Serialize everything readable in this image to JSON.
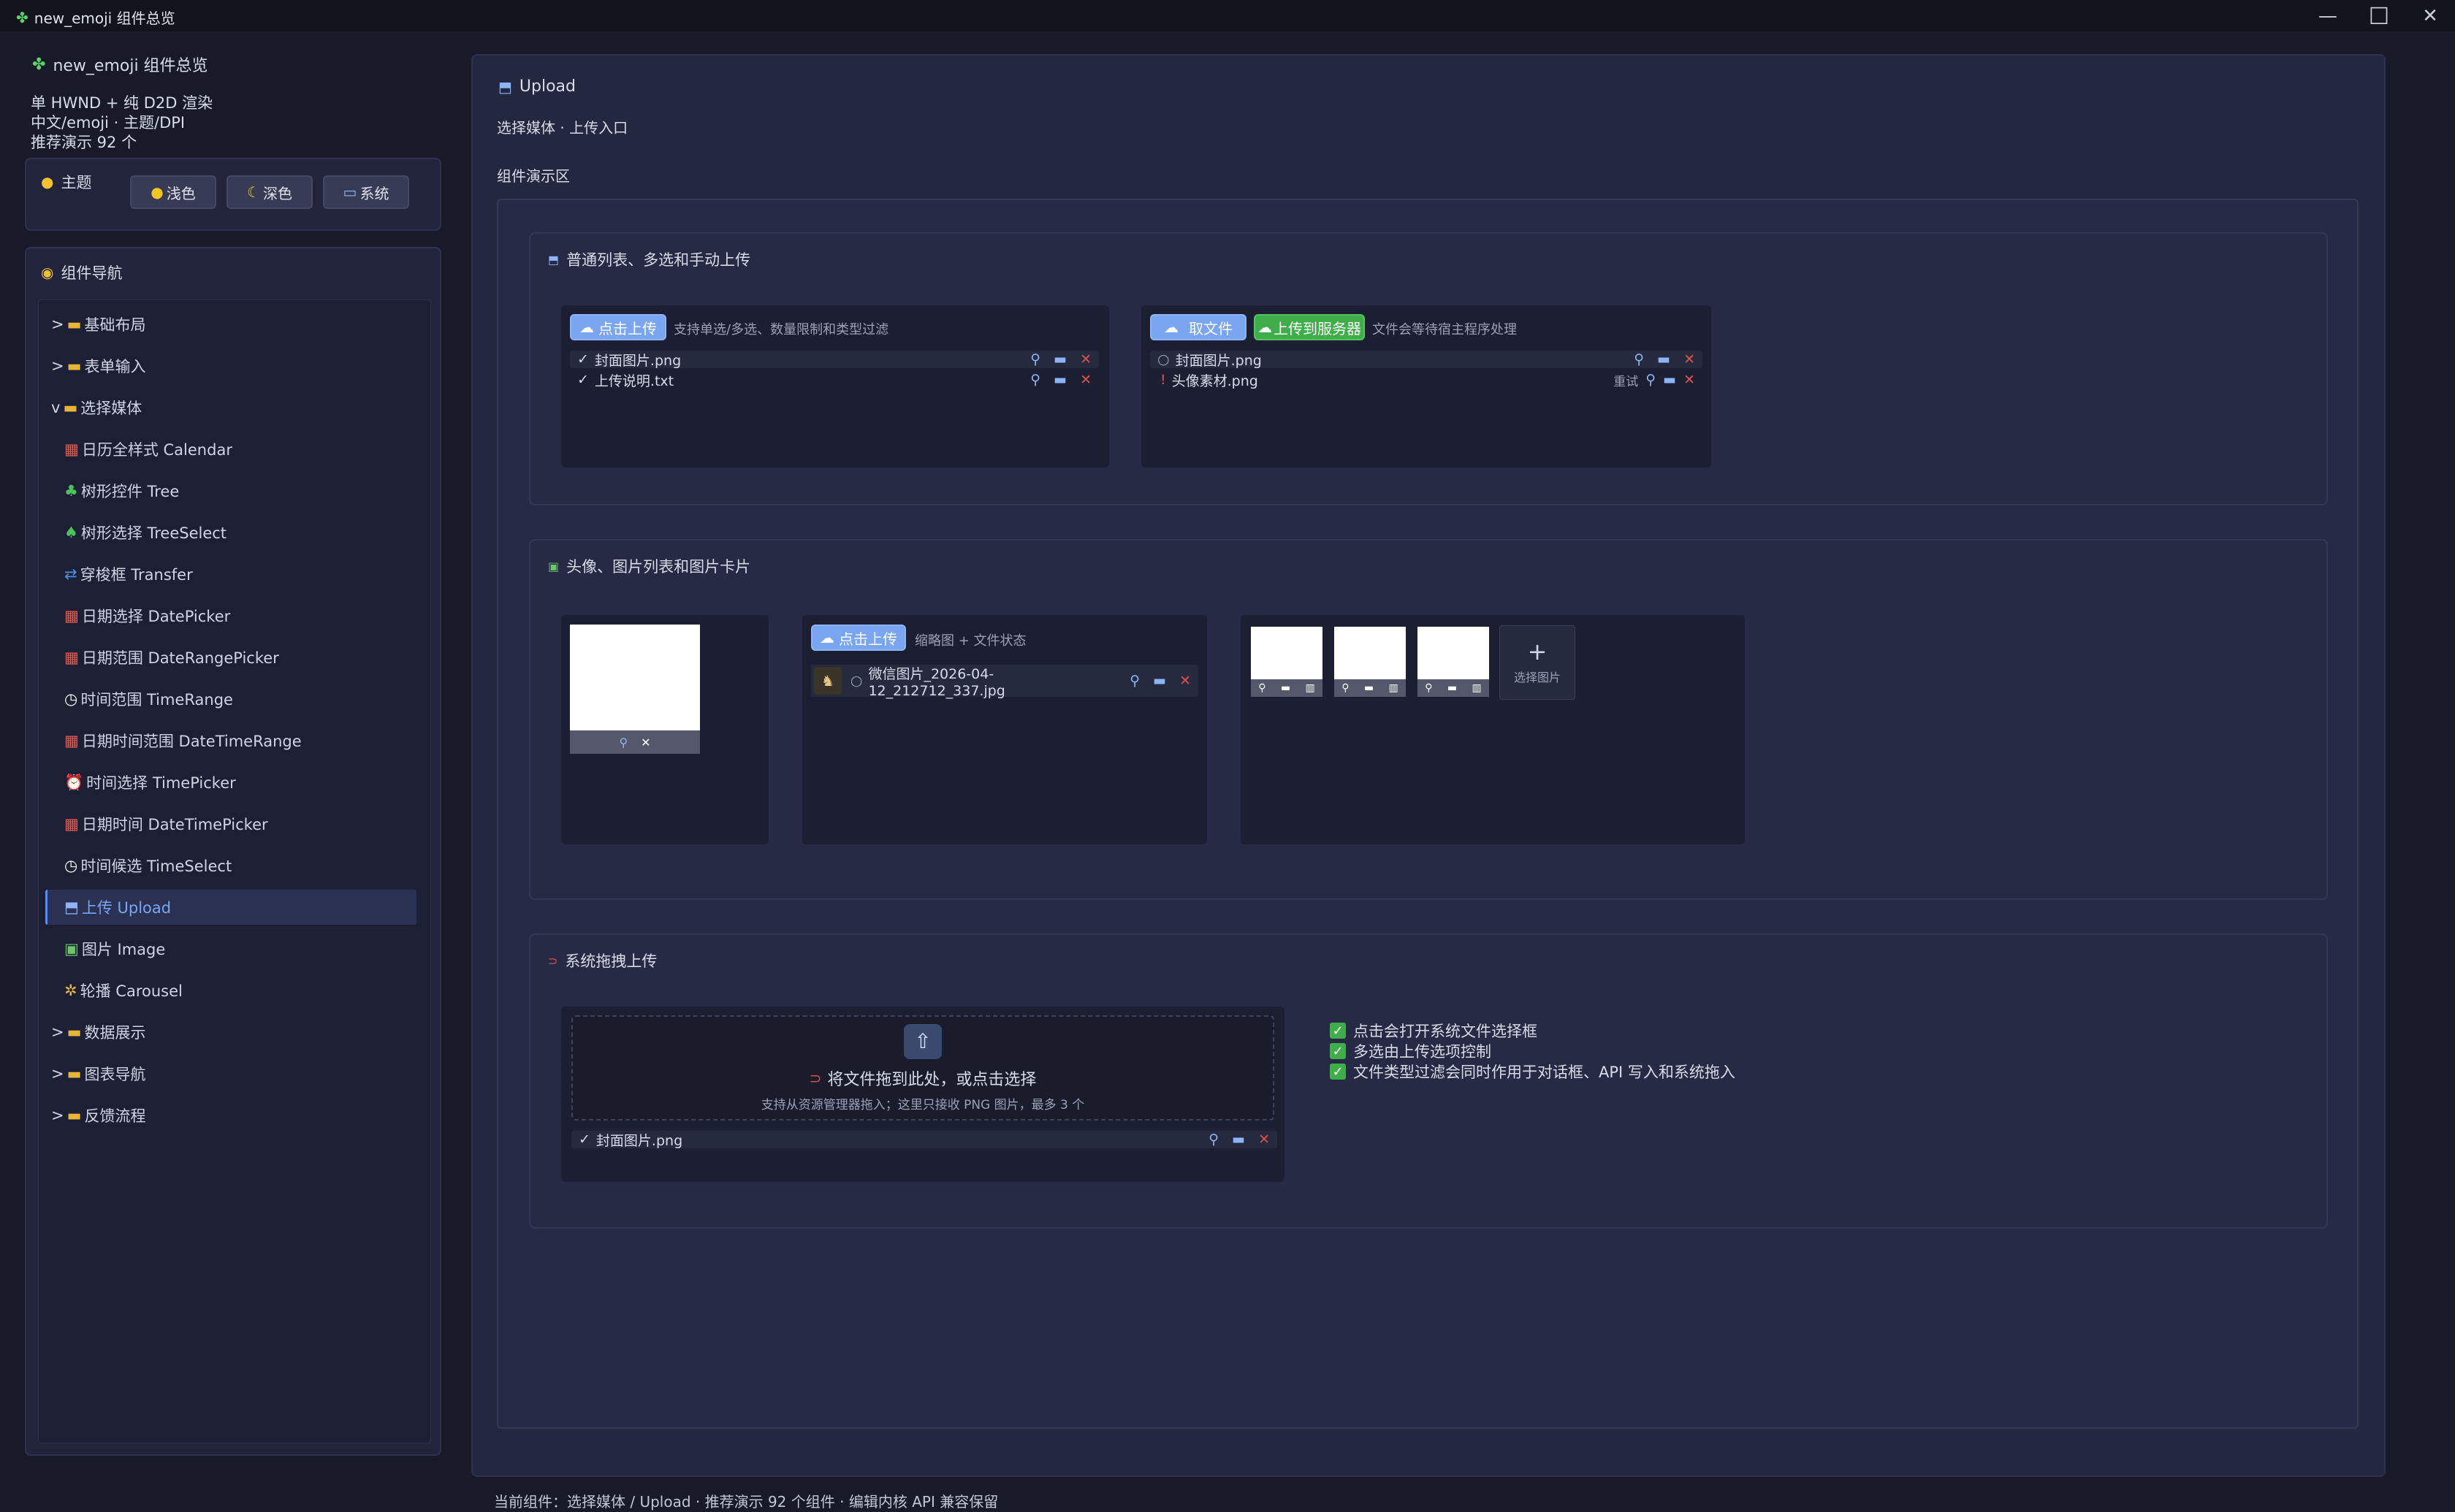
{
  "window": {
    "title": "new_emoji 组件总览",
    "minimize": "—",
    "maximize": "☐",
    "close": "✕"
  },
  "sidebar": {
    "app_title": "new_emoji 组件总览",
    "info_lines": [
      "单 HWND + 纯 D2D 渲染",
      "中文/emoji · 主题/DPI",
      "推荐演示 92 个"
    ],
    "theme_label": "主题",
    "theme_buttons": [
      "浅色",
      "深色",
      "系统"
    ],
    "nav_title": "组件导航",
    "groups": [
      {
        "prefix": ">",
        "label": "基础布局"
      },
      {
        "prefix": ">",
        "label": "表单输入"
      },
      {
        "prefix": "v",
        "label": "选择媒体"
      }
    ],
    "items": [
      {
        "icon": "📅",
        "label": "日历全样式 Calendar"
      },
      {
        "icon": "🌳",
        "label": "树形控件 Tree"
      },
      {
        "icon": "🌲",
        "label": "树形选择 TreeSelect"
      },
      {
        "icon": "🔄",
        "label": "穿梭框 Transfer"
      },
      {
        "icon": "📆",
        "label": "日期选择 DatePicker"
      },
      {
        "icon": "📅",
        "label": "日期范围 DateRangePicker"
      },
      {
        "icon": "🕐",
        "label": "时间范围 TimeRange"
      },
      {
        "icon": "📆",
        "label": "日期时间范围 DateTimeRange"
      },
      {
        "icon": "⏰",
        "label": "时间选择 TimePicker"
      },
      {
        "icon": "📆",
        "label": "日期时间 DateTimePicker"
      },
      {
        "icon": "🕐",
        "label": "时间候选 TimeSelect"
      },
      {
        "icon": "📤",
        "label": "上传 Upload"
      },
      {
        "icon": "🖼",
        "label": "图片 Image"
      },
      {
        "icon": "🎠",
        "label": "轮播 Carousel"
      }
    ],
    "groups_after": [
      {
        "prefix": ">",
        "label": "数据展示"
      },
      {
        "prefix": ">",
        "label": "图表导航"
      },
      {
        "prefix": ">",
        "label": "反馈流程"
      }
    ]
  },
  "main": {
    "title": "Upload",
    "subtitle": "选择媒体 · 上传入口",
    "demo_label": "组件演示区",
    "section1": {
      "title": "普通列表、多选和手动上传",
      "card1": {
        "button": "点击上传",
        "hint": "支持单选/多选、数量限制和类型过滤",
        "files": [
          {
            "mark": "✓",
            "name": "封面图片.png"
          },
          {
            "mark": "✓",
            "name": "上传说明.txt"
          }
        ]
      },
      "card2": {
        "button1": "取文件",
        "button2": "上传到服务器",
        "hint": "文件会等待宿主程序处理",
        "files": [
          {
            "mark": "○",
            "name": "封面图片.png"
          },
          {
            "mark": "!",
            "name": "头像素材.png",
            "retry": "重试"
          }
        ]
      }
    },
    "section2": {
      "title": "头像、图片列表和图片卡片",
      "list_button": "点击上传",
      "list_hint": "缩略图 + 文件状态",
      "list_file": {
        "mark": "○",
        "name": "微信图片_2026-04-12_212712_337.jpg"
      },
      "add_card": {
        "plus": "+",
        "label": "选择图片"
      }
    },
    "section3": {
      "title": "系统拖拽上传",
      "drop_text": "将文件拖到此处，或点击选择",
      "drop_hint": "支持从资源管理器拖入；这里只接收 PNG 图片，最多 3 个",
      "file": {
        "mark": "✓",
        "name": "封面图片.png"
      },
      "checks": [
        "点击会打开系统文件选择框",
        "多选由上传选项控制",
        "文件类型过滤会同时作用于对话框、API 写入和系统拖入"
      ]
    }
  },
  "status": "当前组件：选择媒体 / Upload · 推荐演示 92 个组件 · 编辑内核 API 兼容保留"
}
